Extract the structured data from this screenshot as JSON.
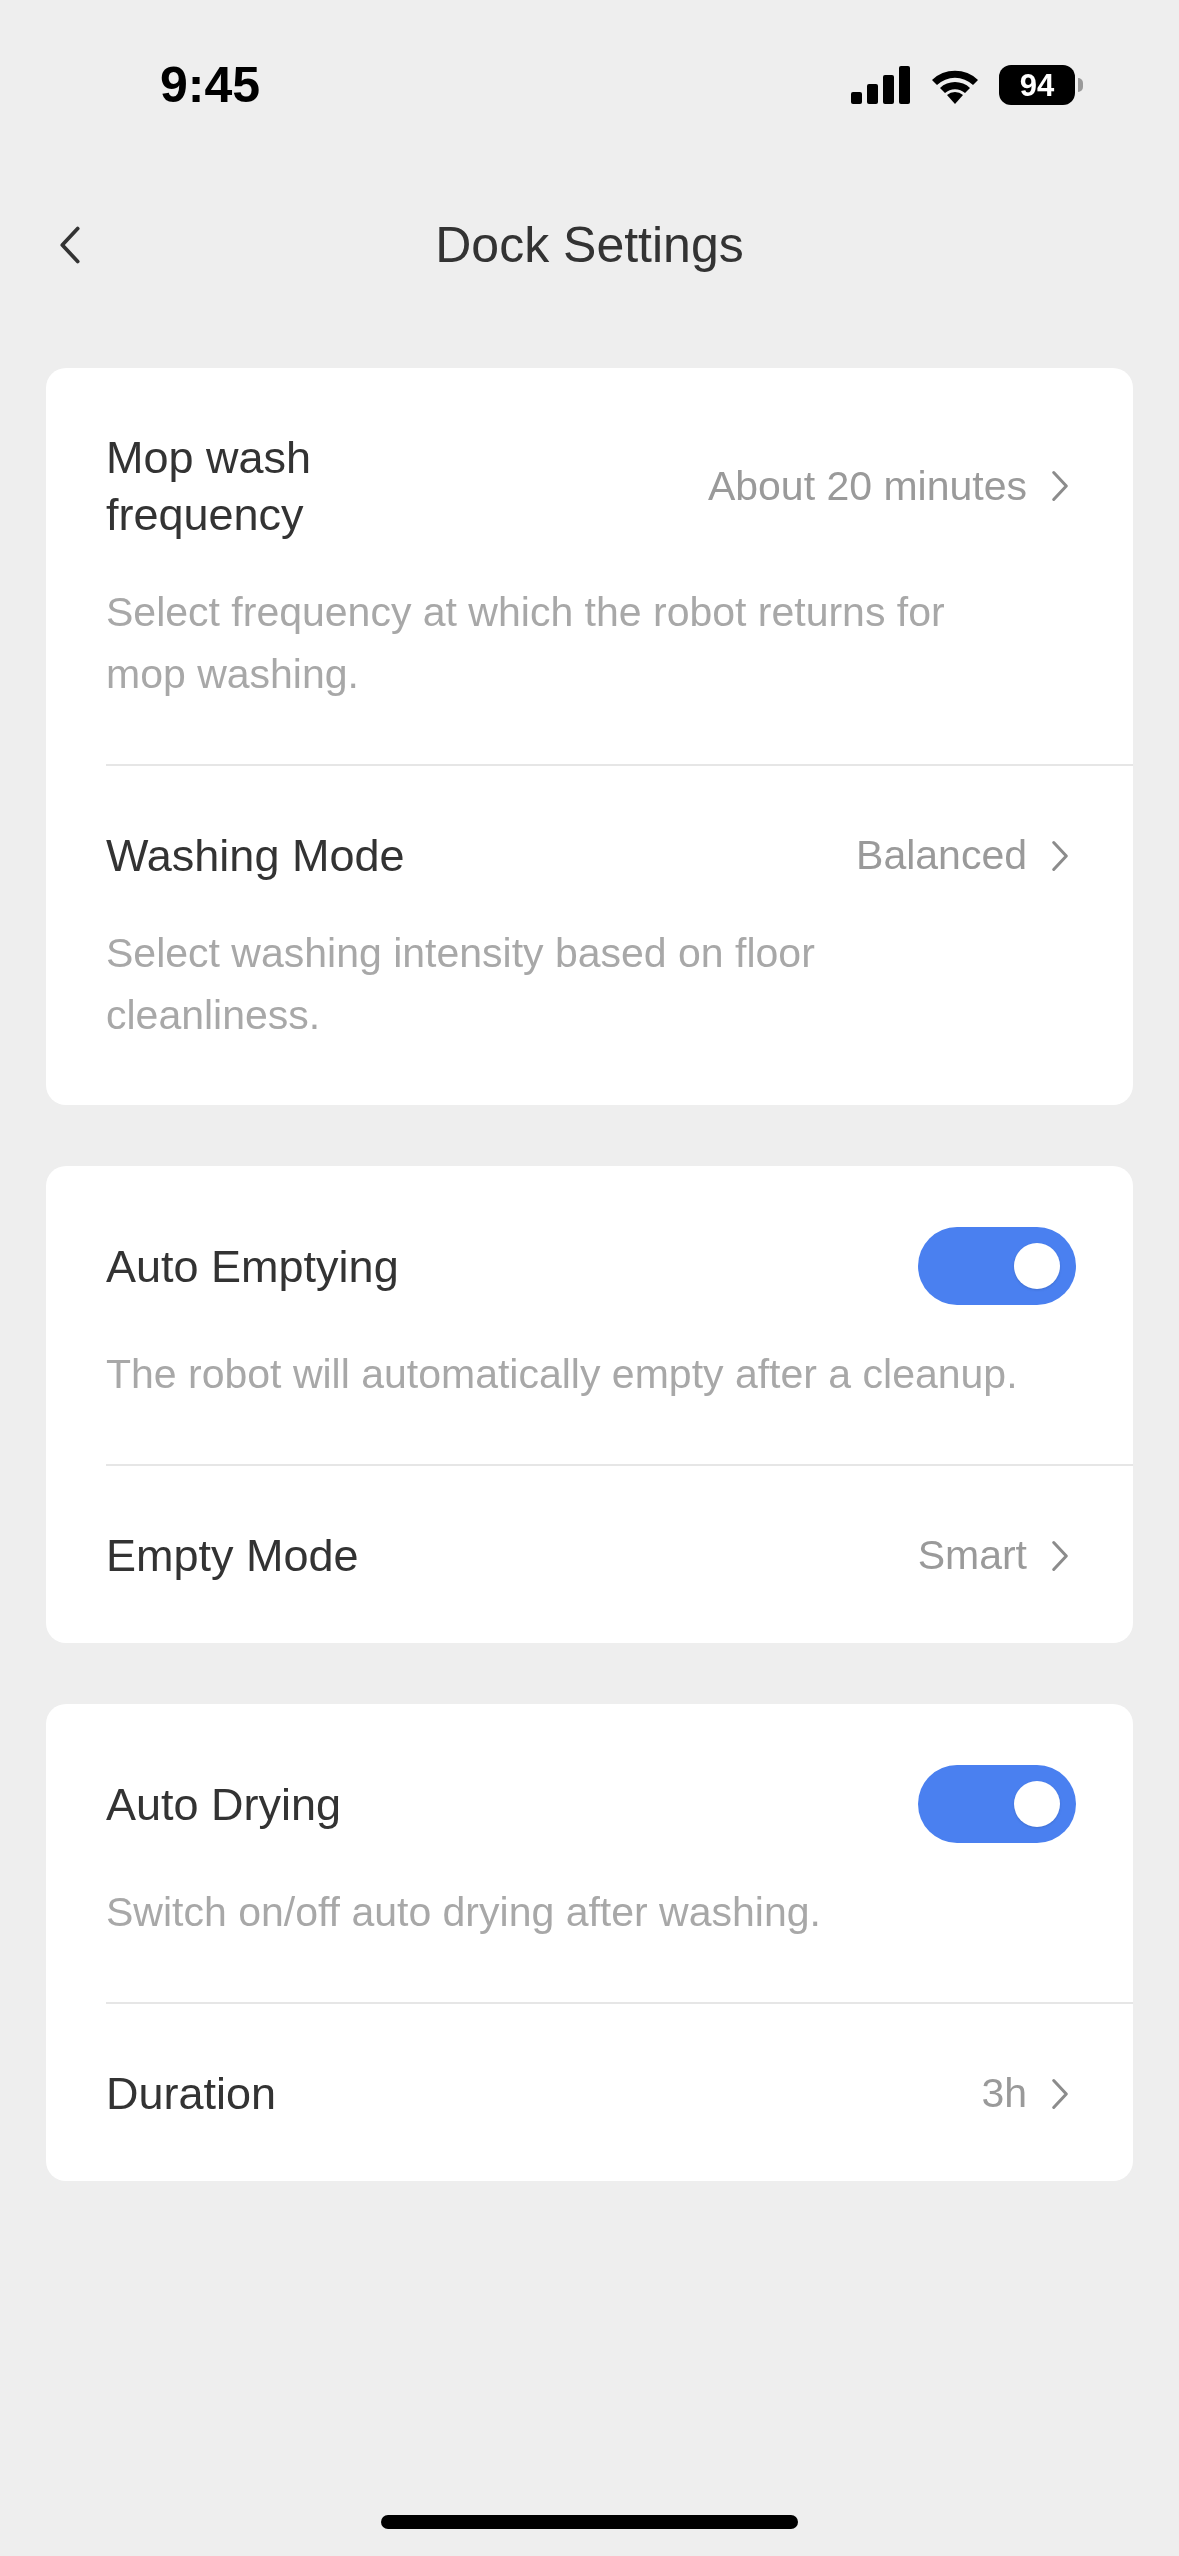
{
  "status_bar": {
    "time": "9:45",
    "battery": "94"
  },
  "header": {
    "title": "Dock Settings"
  },
  "cards": [
    {
      "rows": [
        {
          "kind": "nav",
          "title": "Mop wash frequency",
          "value": "About 20 minutes",
          "description": "Select frequency at which the robot returns for mop washing."
        },
        {
          "kind": "nav",
          "title": "Washing Mode",
          "value": "Balanced",
          "description": "Select washing intensity based on floor cleanliness."
        }
      ]
    },
    {
      "rows": [
        {
          "kind": "toggle",
          "title": "Auto Emptying",
          "on": true,
          "description": "The robot will automatically empty after a cleanup."
        },
        {
          "kind": "nav",
          "title": "Empty Mode",
          "value": "Smart"
        }
      ]
    },
    {
      "rows": [
        {
          "kind": "toggle",
          "title": "Auto Drying",
          "on": true,
          "description": "Switch on/off auto drying after washing."
        },
        {
          "kind": "nav",
          "title": "Duration",
          "value": "3h"
        }
      ]
    }
  ]
}
